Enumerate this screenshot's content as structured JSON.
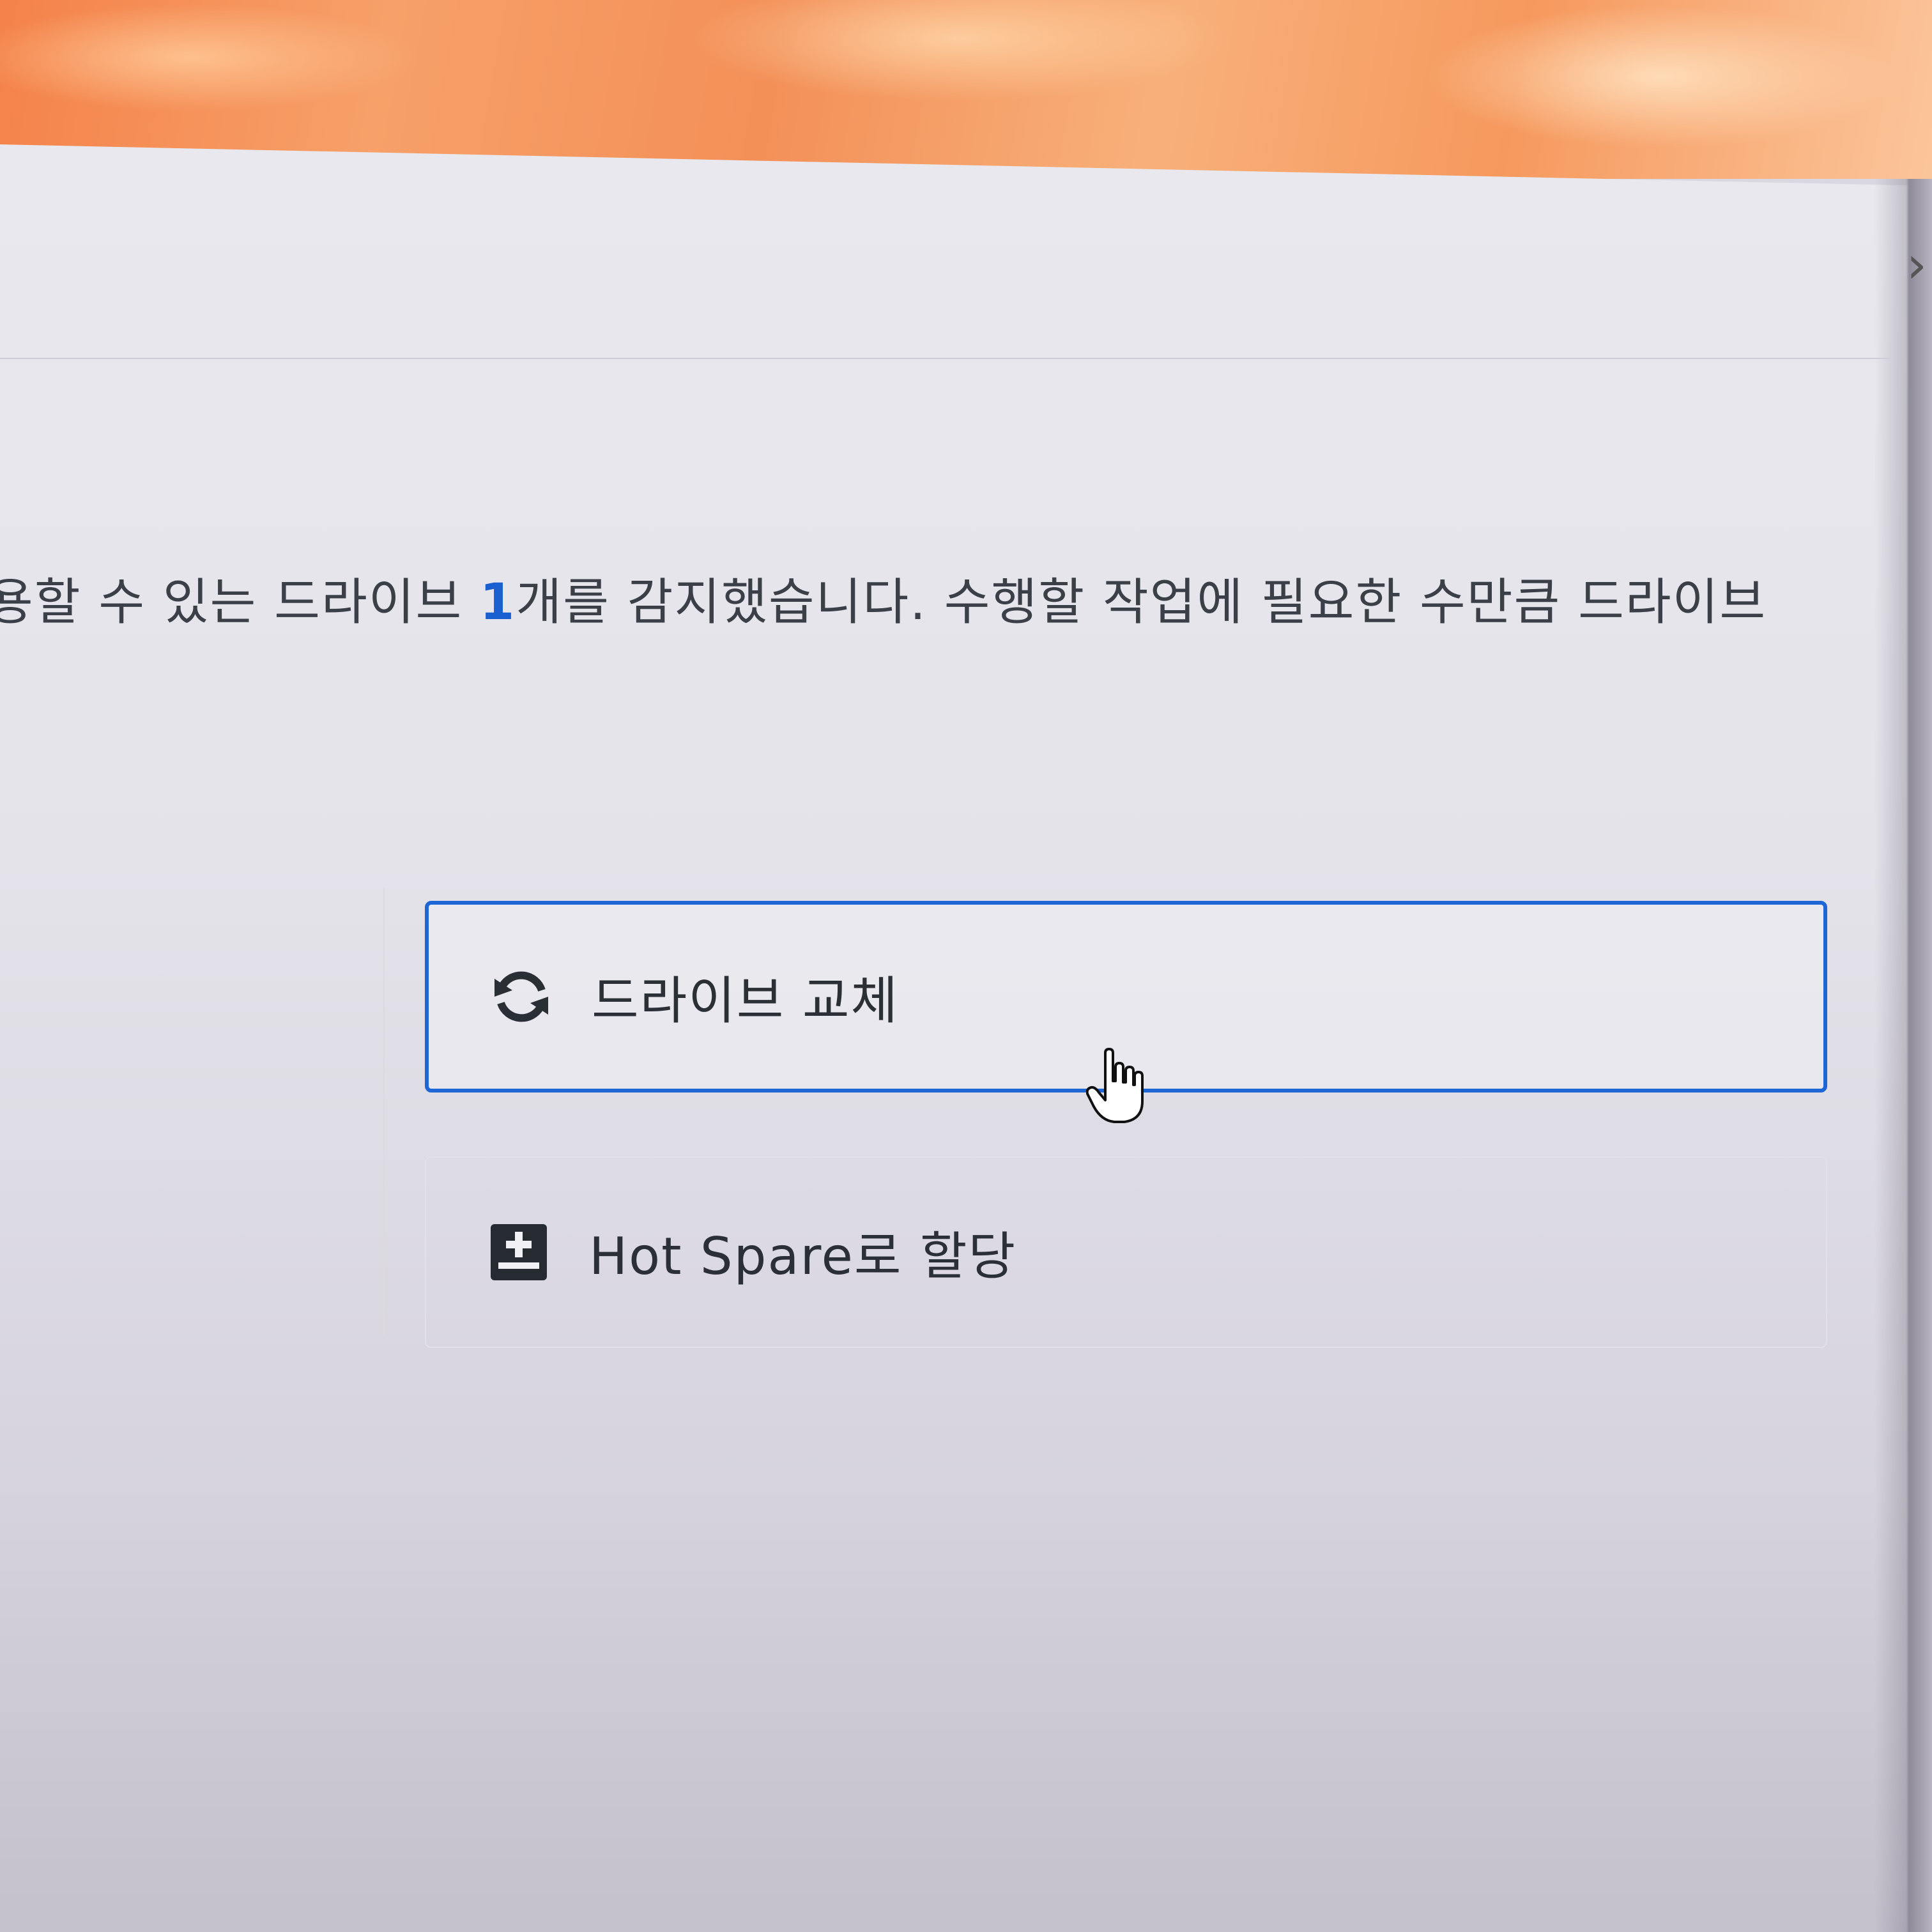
{
  "dialog": {
    "close_glyph": "›",
    "description_prefix": "용할 수 있는 드라이브 ",
    "description_count": "1",
    "description_suffix": "개를 감지했습니다. 수행할 작업에 필요한 수만큼 드라이브"
  },
  "options": [
    {
      "label": "드라이브 교체",
      "icon": "refresh-icon",
      "selected": true
    },
    {
      "label": "Hot Spare로 할당",
      "icon": "add-drive-icon",
      "selected": false
    }
  ],
  "colors": {
    "accent": "#1e66d6",
    "count_highlight": "#1a5fd0",
    "text": "#2b2f36"
  }
}
